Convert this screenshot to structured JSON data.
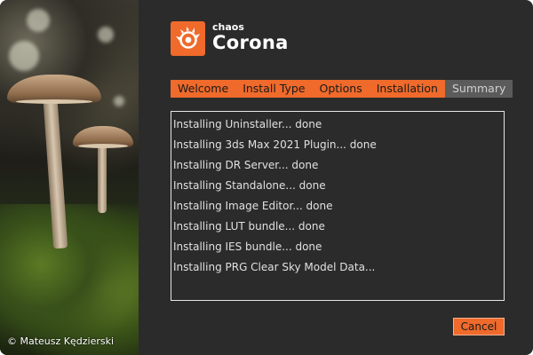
{
  "brand": {
    "company": "chaos",
    "product": "Corona",
    "logo_color": "#ef6a2b"
  },
  "photo": {
    "credit": "© Mateusz Kędzierski"
  },
  "tabs": [
    {
      "label": "Welcome",
      "state": "completed"
    },
    {
      "label": "Install Type",
      "state": "completed"
    },
    {
      "label": "Options",
      "state": "completed"
    },
    {
      "label": "Installation",
      "state": "active"
    },
    {
      "label": "Summary",
      "state": "pending"
    }
  ],
  "log": {
    "lines": [
      "Installing Uninstaller... done",
      "Installing 3ds Max 2021 Plugin... done",
      "Installing DR Server... done",
      "Installing Standalone... done",
      "Installing Image Editor... done",
      "Installing LUT bundle... done",
      "Installing IES bundle... done",
      "Installing PRG Clear Sky Model Data..."
    ]
  },
  "buttons": {
    "cancel_label": "Cancel"
  },
  "colors": {
    "accent": "#ef6a2b",
    "background": "#2b2b2b",
    "inactive_tab": "#5b5b5b"
  }
}
